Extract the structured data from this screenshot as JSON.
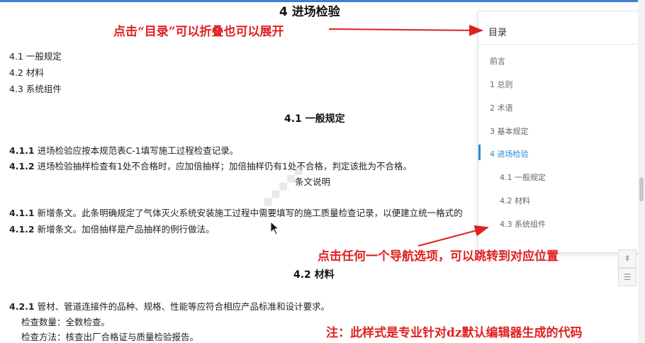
{
  "document": {
    "title": "4 进场检验",
    "links": [
      "4.1 一般规定",
      "4.2 材料",
      "4.3 系统组件"
    ],
    "section_4_1": {
      "heading": "4.1 一般规定",
      "p1_num": "4.1.1",
      "p1_text": " 进场检验应按本规范表C-1填写施工过程检查记录。",
      "p2_num": "4.1.2",
      "p2_text": " 进场检验抽样检查有1处不合格时，应加倍抽样；加倍抽样仍有1处不合格，判定该批为不合格。",
      "explain_heading": "条文说明",
      "e1_num": "4.1.1",
      "e1_text": " 新增条文。此条明确规定了气体灭火系统安装施工过程中需要填写的施工质量检查记录，以便建立统一格式的",
      "e2_num": "4.1.2",
      "e2_text": " 新增条文。加倍抽样是产品抽样的例行做法。"
    },
    "section_4_2": {
      "heading": "4.2 材料",
      "p1_num": "4.2.1",
      "p1_text": " 管材、管道连接件的品种、规格、性能等应符合相应产品标准和设计要求。",
      "p2": "检查数量：全数检查。",
      "p3": "检查方法：核查出厂合格证与质量检验报告。"
    }
  },
  "toc": {
    "title": "目录",
    "items": [
      {
        "label": "前言"
      },
      {
        "label": "1 总则"
      },
      {
        "label": "2 术语"
      },
      {
        "label": "3 基本规定"
      },
      {
        "label": "4 进场检验",
        "active": true
      },
      {
        "label": "4.1 一般规定"
      },
      {
        "label": "4.2 材料"
      },
      {
        "label": "4.3 系统组件"
      }
    ]
  },
  "annotations": {
    "a1": "点击“目录”可以折叠也可以展开",
    "a2": "点击任何一个导航选项，可以跳转到对应位置",
    "a3": "注：此样式是专业针对dz默认编辑器生成的代码"
  },
  "colors": {
    "annotation": "#e02020",
    "active": "#2a8ad4",
    "arrow": "#e02020"
  },
  "icons": {
    "back_to_top": "arrow-up-icon",
    "toc_toggle": "list-icon"
  }
}
